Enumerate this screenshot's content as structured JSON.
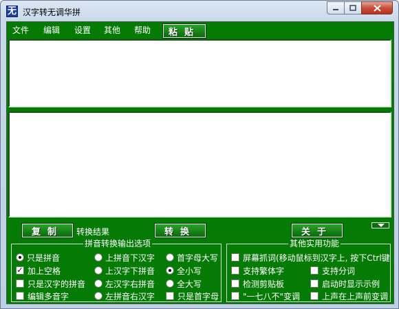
{
  "window": {
    "title": "汉字转无调华拼",
    "icon_glyph": "无"
  },
  "menu": {
    "items": [
      "文件",
      "编辑",
      "设置",
      "其他",
      "帮助"
    ]
  },
  "buttons": {
    "paste": "粘贴",
    "copy": "复制",
    "convert": "转换",
    "about": "关于"
  },
  "labels": {
    "result": "转换结果"
  },
  "pinyin_group": {
    "title": "拼音转换输出选项",
    "options": [
      {
        "label": "只是拼音",
        "type": "radio",
        "checked": true
      },
      {
        "label": "上拼音下汉字",
        "type": "radio",
        "checked": false
      },
      {
        "label": "首字母大写",
        "type": "radio",
        "checked": false
      },
      {
        "label": "加上空格",
        "type": "checkbox",
        "checked": true
      },
      {
        "label": "上汉字下拼音",
        "type": "radio",
        "checked": false
      },
      {
        "label": "全小写",
        "type": "radio",
        "checked": true
      },
      {
        "label": "只是汉字的拼音",
        "type": "checkbox",
        "checked": false
      },
      {
        "label": "左汉字右拼音",
        "type": "radio",
        "checked": false
      },
      {
        "label": "全大写",
        "type": "radio",
        "checked": false
      },
      {
        "label": "编辑多音字",
        "type": "checkbox",
        "checked": false
      },
      {
        "label": "左拼音右汉字",
        "type": "radio",
        "checked": false
      },
      {
        "label": "只是首字母",
        "type": "checkbox",
        "checked": false
      }
    ]
  },
  "other_group": {
    "title": "其他实用功能",
    "options": [
      {
        "label": "屏幕抓词(移动鼠标到汉字上, 按下Ctrl键",
        "checked": false
      },
      {
        "label": "支持繁体字",
        "checked": false
      },
      {
        "label": "支持分词",
        "checked": false
      },
      {
        "label": "检测剪贴板",
        "checked": false
      },
      {
        "label": "启动时显示示例",
        "checked": false
      },
      {
        "label": "\"一七八不\"变调",
        "checked": false
      },
      {
        "label": "上声在上声前变调",
        "checked": false
      }
    ]
  },
  "colors": {
    "client_green": "#057a05",
    "button_green": "#0b6a0b"
  }
}
